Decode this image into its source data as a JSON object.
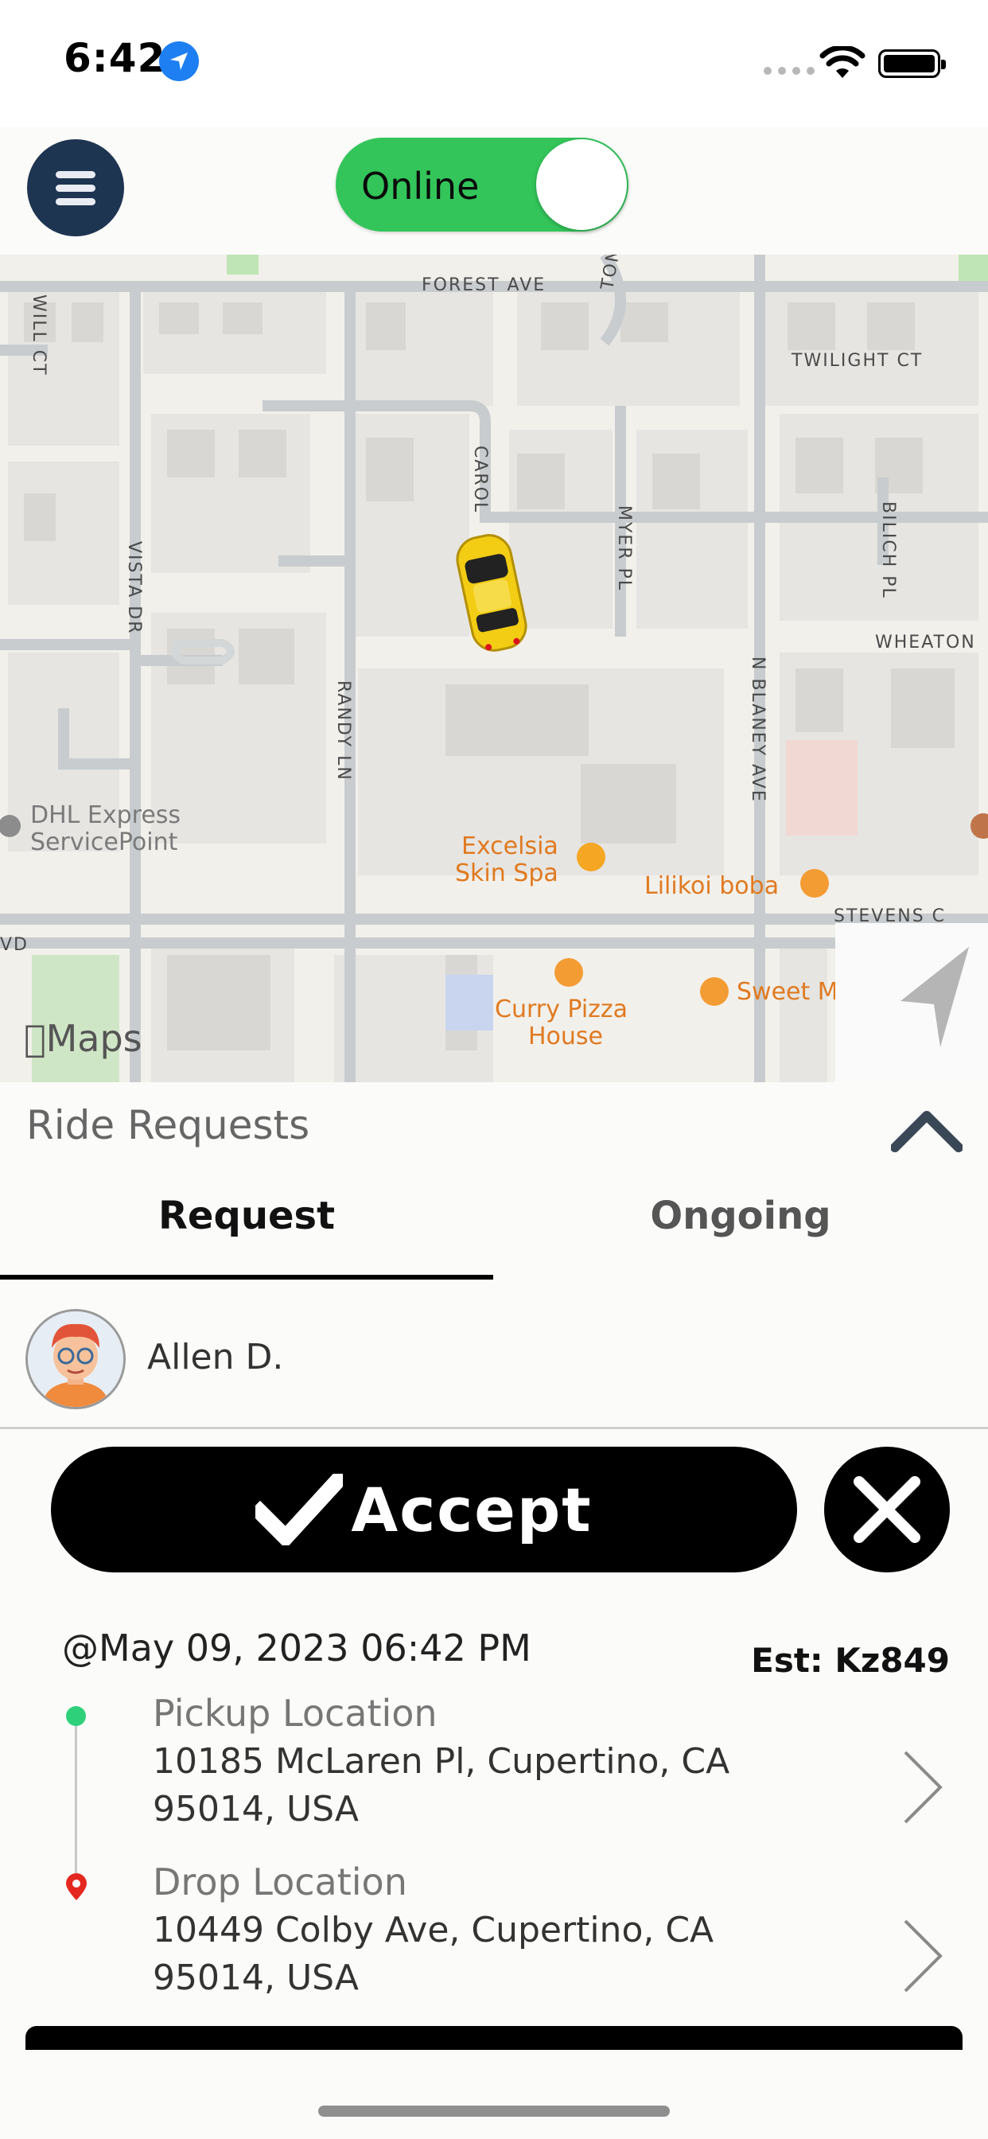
{
  "status_bar": {
    "time": "6:42",
    "location_icon": "location-arrow-icon",
    "signal_icon": "signal-dots-icon",
    "wifi_icon": "wifi-icon",
    "battery_icon": "battery-icon"
  },
  "header": {
    "menu_icon": "hamburger-menu-icon",
    "online_toggle": {
      "label": "Online",
      "state": "on",
      "color": "#33c55a"
    }
  },
  "map": {
    "streets": [
      "FOREST AVE",
      "WILL CT",
      "TONI CT",
      "TWILIGHT CT",
      "CAROL",
      "MYER PL",
      "BILICH PL",
      "VISTA DR",
      "WHEATON",
      "RANDY LN",
      "N BLANEY AVE",
      "STEVENS C",
      "VD"
    ],
    "pois": [
      {
        "name_line1": "DHL Express",
        "name_line2": "ServicePoint",
        "color": "#7a7a7a"
      },
      {
        "name_line1": "Excelsia",
        "name_line2": "Skin Spa",
        "color": "#e07a20"
      },
      {
        "name_line1": "Lilikoi boba",
        "color": "#e07a20"
      },
      {
        "name_line1": "Curry Pizza",
        "name_line2": "House",
        "color": "#e07a20"
      },
      {
        "name_line1": "Sweet M",
        "color": "#e07a20"
      }
    ],
    "attribution": "Maps",
    "car_icon": "taxi-car-icon",
    "recenter_icon": "navigation-arrow-icon"
  },
  "panel": {
    "title": "Ride Requests",
    "collapse_icon": "chevron-up-icon",
    "tabs": [
      {
        "label": "Request",
        "active": true
      },
      {
        "label": "Ongoing",
        "active": false
      }
    ]
  },
  "request": {
    "rider_name": "Allen D.",
    "accept_label": "Accept",
    "datetime": "@May 09, 2023 06:42 PM",
    "estimate": "Est: Kz849",
    "pickup": {
      "label": "Pickup Location",
      "address_line1": "10185 McLaren Pl, Cupertino, CA",
      "address_line2": "95014, USA",
      "color": "#2ed17a"
    },
    "drop": {
      "label": "Drop Location",
      "address_line1": "10449 Colby Ave, Cupertino, CA",
      "address_line2": "95014, USA",
      "color": "#e5281f"
    }
  }
}
